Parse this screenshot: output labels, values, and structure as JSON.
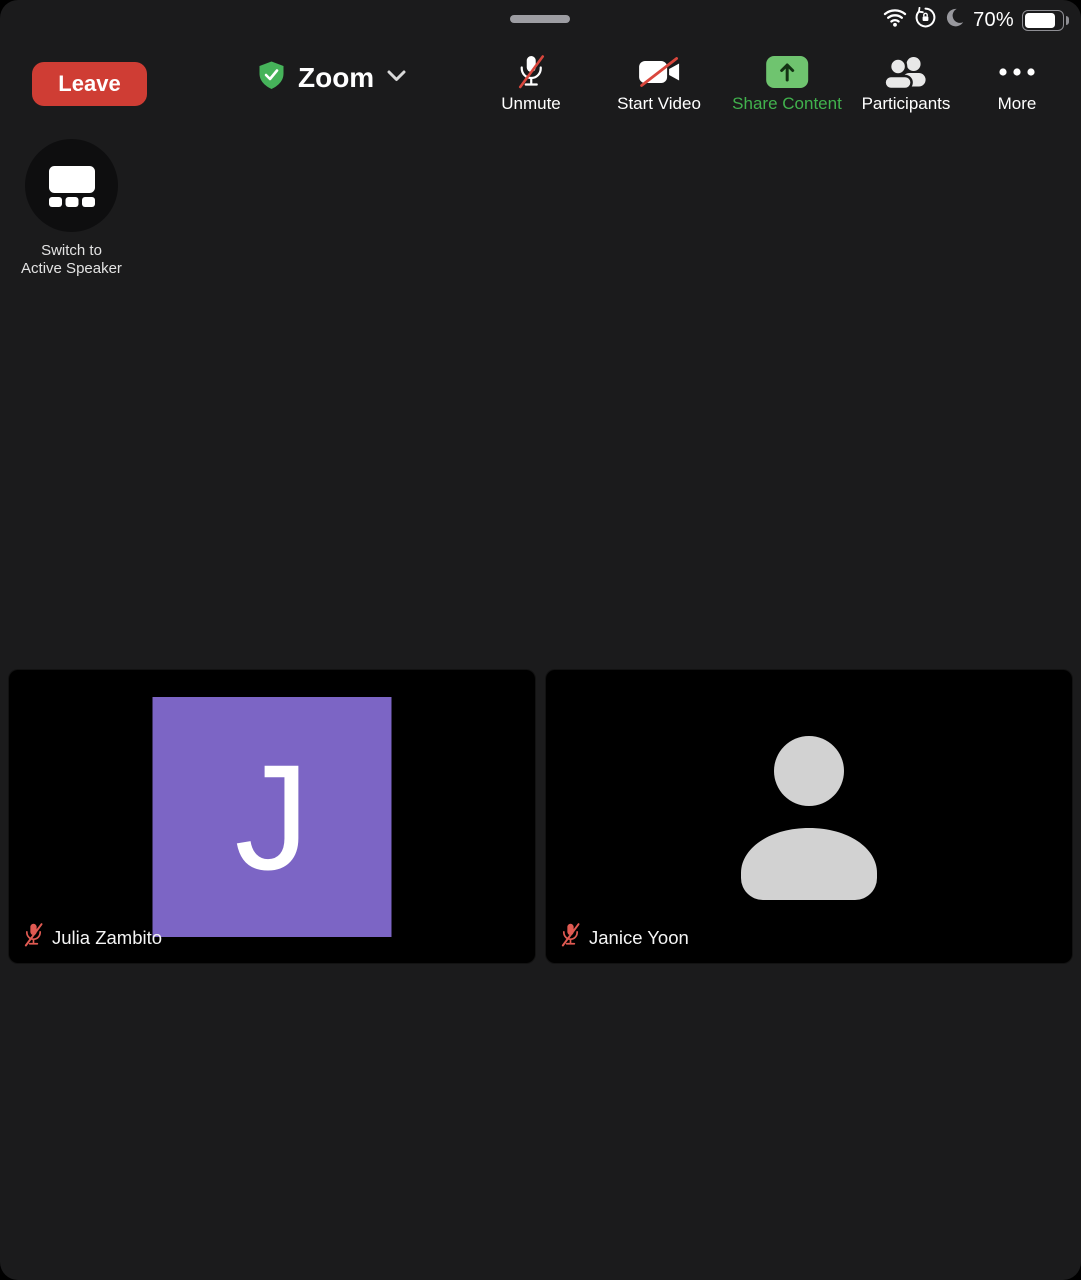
{
  "status_bar": {
    "battery_percent": "70%",
    "icons": [
      "wifi-icon",
      "orientation-lock-icon",
      "do-not-disturb-moon-icon",
      "battery-icon"
    ]
  },
  "toolbar": {
    "leave_label": "Leave",
    "meeting_title": "Zoom",
    "buttons": [
      {
        "id": "unmute",
        "label": "Unmute",
        "icon": "mic-muted-icon",
        "state": "muted"
      },
      {
        "id": "start-video",
        "label": "Start Video",
        "icon": "video-muted-icon",
        "state": "off"
      },
      {
        "id": "share-content",
        "label": "Share Content",
        "icon": "share-up-arrow-icon"
      },
      {
        "id": "participants",
        "label": "Participants",
        "icon": "participants-icon"
      },
      {
        "id": "more",
        "label": "More",
        "icon": "ellipsis-icon"
      }
    ]
  },
  "view_switch": {
    "line1": "Switch to",
    "line2": "Active Speaker"
  },
  "tiles": [
    {
      "name": "Julia Zambito",
      "avatar_letter": "J",
      "avatar_color": "#7C65C5",
      "muted": true
    },
    {
      "name": "Janice Yoon",
      "avatar": "silhouette",
      "muted": true
    }
  ],
  "colors": {
    "background": "#1B1B1C",
    "tile_background": "#000000",
    "leave_red": "#CF3D34",
    "share_green_square": "#6FC46F",
    "share_green_label": "#41B24D",
    "avatar_purple": "#7C65C5",
    "muted_red": "#D9463C",
    "shield_green": "#46B35A"
  }
}
